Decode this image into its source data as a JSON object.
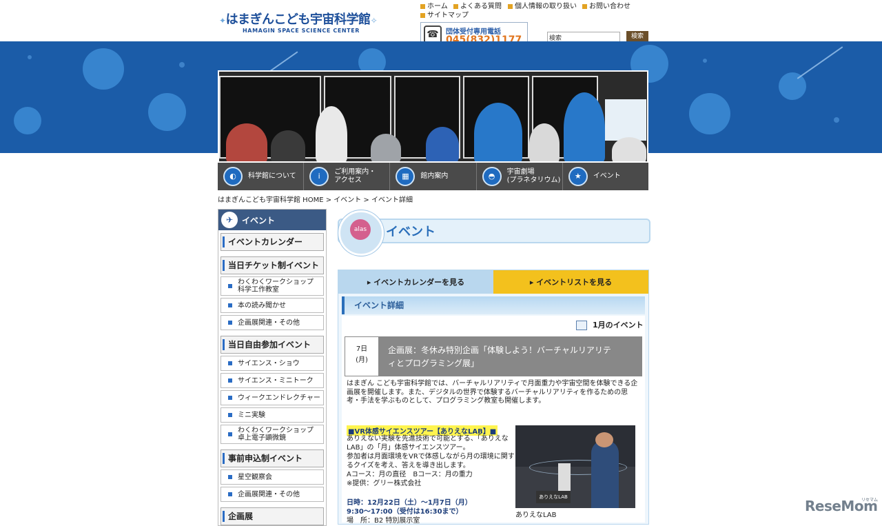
{
  "header": {
    "logo_jp": "はまぎんこども宇宙科学館",
    "logo_en": "HAMAGIN SPACE SCIENCE CENTER",
    "top_links": [
      "ホーム",
      "よくある質問",
      "個人情報の取り扱い",
      "お問い合わせ",
      "サイトマップ"
    ],
    "tel_label": "団体受付専用電話",
    "tel_number": "045(832)1177",
    "search_placeholder": "検索",
    "search_button": "検索"
  },
  "main_nav": [
    {
      "label": "科学館について",
      "icon": "planet-icon"
    },
    {
      "label": "ご利用案内・\nアクセス",
      "icon": "info-icon"
    },
    {
      "label": "館内案内",
      "icon": "floor-icon"
    },
    {
      "label": "宇宙劇場\n(プラネタリウム)",
      "icon": "planetarium-icon"
    },
    {
      "label": "イベント",
      "icon": "event-icon"
    }
  ],
  "breadcrumb": "はまぎんこども宇宙科学館 HOME >  イベント >  イベント詳細",
  "sidebar": {
    "title": "イベント",
    "sections": [
      {
        "label": "イベントカレンダー",
        "items": []
      },
      {
        "label": "当日チケット制イベント",
        "items": [
          "わくわくワークショップ\n科学工作教室",
          "本の読み聞かせ",
          "企画展関連・その他"
        ]
      },
      {
        "label": "当日自由参加イベント",
        "items": [
          "サイエンス・ショウ",
          "サイエンス・ミニトーク",
          "ウィークエンドレクチャー",
          "ミニ実験",
          "わくわくワークショップ\n卓上電子顕微鏡"
        ]
      },
      {
        "label": "事前申込制イベント",
        "items": [
          "星空観察会",
          "企画展関連・その他"
        ]
      },
      {
        "label": "企画展",
        "items": []
      }
    ]
  },
  "page_title": "イベント",
  "mascot_label": "alas",
  "tabs": {
    "calendar": "▸ イベントカレンダーを見る",
    "list": "▸ イベントリストを見る"
  },
  "detail_heading": "イベント詳細",
  "month_link": "1月のイベント",
  "event": {
    "day": "7日",
    "weekday": "(月)",
    "title": "企画展：冬休み特別企画「体験しよう！バーチャルリアリティとプログラミング展」"
  },
  "description": "はまぎん こども宇宙科学館では、バーチャルリアリティで月面重力や宇宙空間を体験できる企画展を開催します。また、デジタルの世界で体験するバーチャルリアリティを作るための思考・手法を学ぶものとして、プログラミング教室も開催します。",
  "section": {
    "title": "■VR体感サイエンスツアー【ありえなLAB】■",
    "body": "ありえない実験を先進技術で可能とする、「ありえなLAB」の「月」体感サイエンスツアー。\n参加者は月面環境をVRで体感しながら月の環境に関するクイズを考え、答えを導き出します。\nAコース：月の直径　Bコース：月の重力\n※提供：グリー株式会社",
    "photo_caption": "ありえなLAB",
    "photo_sign": "ありえなLAB",
    "date_line1": "日時：12月22日（土）～1月7日（月）",
    "date_line2": "9:30～17:00（受付は16:30まで）",
    "place_line": "場　所：B2 特別展示室"
  },
  "watermark": "ReseMom",
  "watermark_sub": "リセマム",
  "colors": {
    "brand_blue": "#1b5ca8",
    "accent_yellow": "#f3c11d",
    "nav_dark": "#4a4a4a",
    "tel_orange": "#e0741e"
  }
}
